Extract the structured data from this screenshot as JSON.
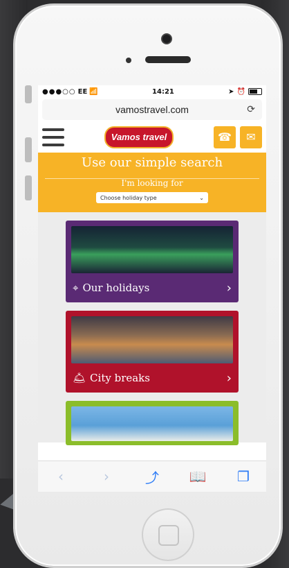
{
  "status": {
    "carrier": "EE",
    "time": "14:21"
  },
  "browser": {
    "url": "vamostravel.com"
  },
  "header": {
    "logo_text": "Vamos travel"
  },
  "search": {
    "title": "Use our simple search",
    "subtitle": "I'm looking for",
    "select_value": "Choose holiday type"
  },
  "cards": [
    {
      "label": "Our holidays",
      "icon": "location-pin-icon"
    },
    {
      "label": "City breaks",
      "icon": "city-icon"
    },
    {
      "label": "",
      "icon": ""
    }
  ],
  "colors": {
    "accent": "#f7b326",
    "purple": "#5a2a74",
    "red": "#b0122b",
    "green": "#8bbd2a"
  }
}
